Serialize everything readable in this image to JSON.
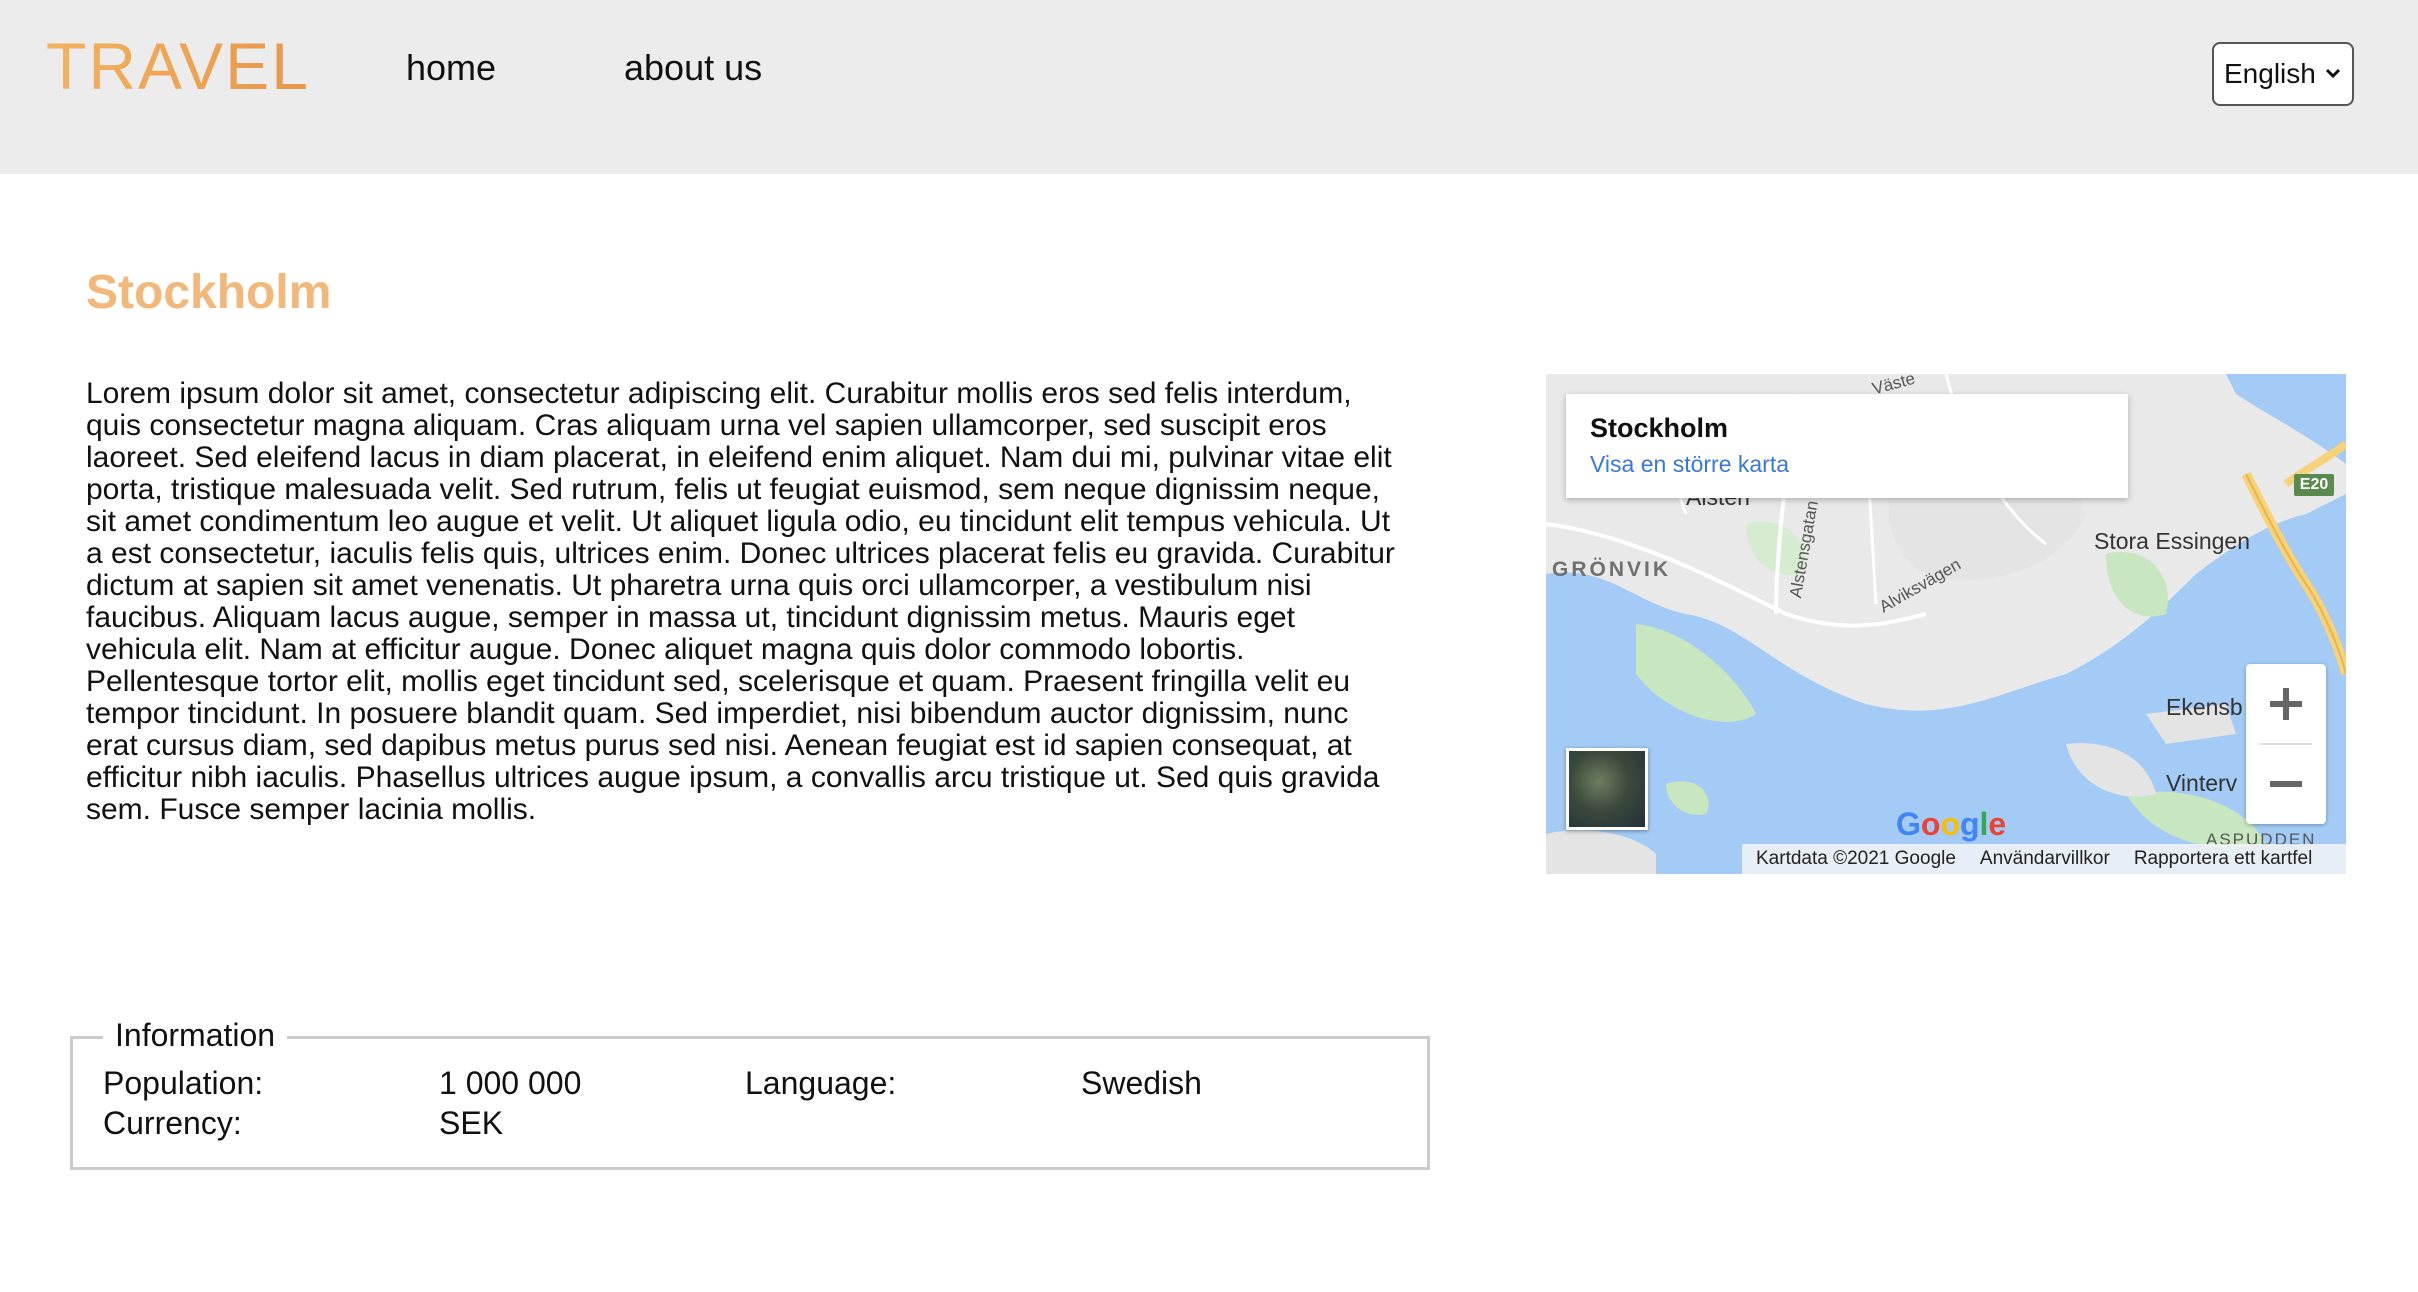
{
  "header": {
    "logo": "TRAVEL",
    "nav": [
      {
        "label": "home"
      },
      {
        "label": "about us"
      }
    ],
    "language_select": {
      "value": "English"
    }
  },
  "city": {
    "title": "Stockholm",
    "description": "Lorem ipsum dolor sit amet, consectetur adipiscing elit. Curabitur mollis eros sed felis interdum, quis consectetur magna aliquam. Cras aliquam urna vel sapien ullamcorper, sed suscipit eros laoreet. Sed eleifend lacus in diam placerat, in eleifend enim aliquet. Nam dui mi, pulvinar vitae elit porta, tristique malesuada velit. Sed rutrum, felis ut feugiat euismod, sem neque dignissim neque, sit amet condimentum leo augue et velit. Ut aliquet ligula odio, eu tincidunt elit tempus vehicula. Ut a est consectetur, iaculis felis quis, ultrices enim. Donec ultrices placerat felis eu gravida. Curabitur dictum at sapien sit amet venenatis. Ut pharetra urna quis orci ullamcorper, a vestibulum nisi faucibus. Aliquam lacus augue, semper in massa ut, tincidunt dignissim metus. Mauris eget vehicula elit. Nam at efficitur augue. Donec aliquet magna quis dolor commodo lobortis. Pellentesque tortor elit, mollis eget tincidunt sed, scelerisque et quam. Praesent fringilla velit eu tempor tincidunt. In posuere blandit quam. Sed imperdiet, nisi bibendum auctor dignissim, nunc erat cursus diam, sed dapibus metus purus sed nisi. Aenean feugiat est id sapien consequat, at efficitur nibh iaculis. Phasellus ultrices augue ipsum, a convallis arcu tristique ut. Sed quis gravida sem. Fusce semper lacinia mollis."
  },
  "map": {
    "card_title": "Stockholm",
    "card_link": "Visa en större karta",
    "labels": {
      "alsten": "Alsten",
      "gronvik": "GRÖNVIK",
      "stora_essingen": "Stora Essingen",
      "ekensb": "Ekensb",
      "vinterv": "Vinterv",
      "asp": "ASPUDDEN",
      "alviksvagen": "Alviksvägen",
      "alstensgatan": "Alstensgatan",
      "vaste": "Väste"
    },
    "road_badge": "E20",
    "google": "Google",
    "footer": [
      "Kartdata ©2021 Google",
      "Användarvillkor",
      "Rapportera ett kartfel"
    ],
    "zoom_in_icon": "plus-icon",
    "zoom_out_icon": "minus-icon",
    "colors": {
      "water": "#a3cbf5",
      "land": "#e9e9e9",
      "park": "#c8e6c0",
      "road": "#ffffff",
      "highway": "#f6d27a"
    }
  },
  "information": {
    "legend": "Information",
    "rows": [
      {
        "label": "Population:",
        "value": "1 000 000",
        "label2": "Language:",
        "value2": "Swedish"
      },
      {
        "label": "Currency:",
        "value": "SEK"
      }
    ]
  },
  "colors": {
    "accent_title": "#f3b77a",
    "logo_start": "#f2b35e",
    "logo_end": "#e8964a",
    "header_bg": "#ececec"
  }
}
